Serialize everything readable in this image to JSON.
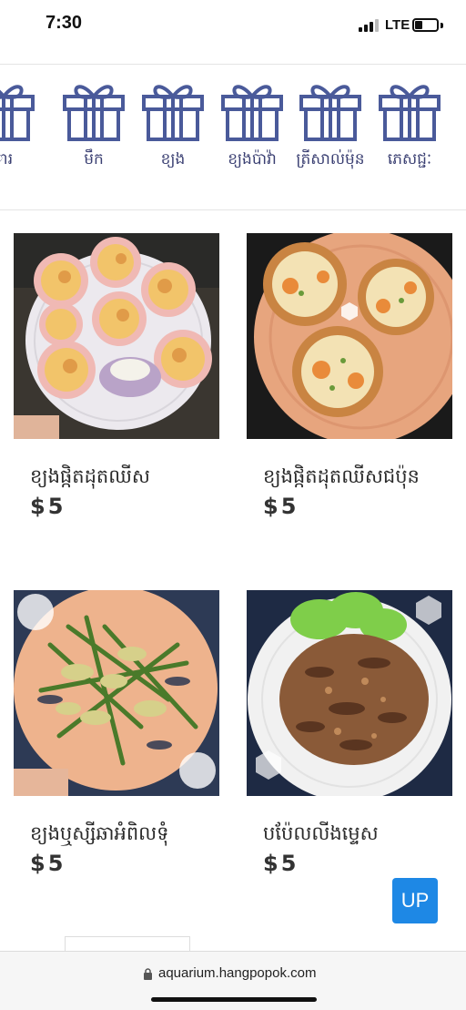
{
  "status": {
    "time": "7:30",
    "network": "LTE"
  },
  "categories": [
    {
      "label": "ារ",
      "icon": "gift-icon"
    },
    {
      "label": "មឹក",
      "icon": "gift-icon"
    },
    {
      "label": "ខ្យង",
      "icon": "gift-icon"
    },
    {
      "label": "ខ្យងប៉ាវ៉ា",
      "icon": "gift-icon"
    },
    {
      "label": "ត្រីសាល់ម៉ុន",
      "icon": "gift-icon"
    },
    {
      "label": "ភេសជ្ជៈ",
      "icon": "gift-icon"
    }
  ],
  "products": [
    {
      "name": "ខ្យងផ្កិតដុតឈីស",
      "price": "$5"
    },
    {
      "name": "ខ្យងផ្កិតដុតឈីសជប៉ុន",
      "price": "$5"
    },
    {
      "name": "ខ្យងឬស្សីឆាអំពិលទុំ",
      "price": "$5"
    },
    {
      "name": "បប៉ែលលីងម្ទេស",
      "price": "$5"
    }
  ],
  "up_button": {
    "label": "UP"
  },
  "browser": {
    "url": "aquarium.hangpopok.com"
  },
  "colors": {
    "accent": "#1e88e5",
    "icon": "#4a5a9a"
  }
}
